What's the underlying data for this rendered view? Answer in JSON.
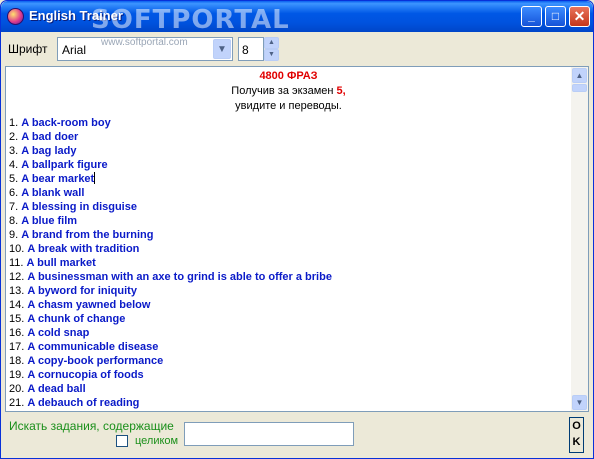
{
  "window": {
    "title": "English Trainer",
    "watermark": "SOFTPORTAL",
    "watermark_url": "www.softportal.com",
    "minimize": "_",
    "maximize": "□",
    "close": "✕"
  },
  "toolbar": {
    "font_label": "Шрифт",
    "font_value": "Arial",
    "size_value": "8"
  },
  "content": {
    "count": "4800 ФРАЗ",
    "line1_prefix": "Получив за экзамен ",
    "line1_num": "5,",
    "line2": "увидите и переводы.",
    "phrases": [
      {
        "num": "1.",
        "text": "A back-room boy"
      },
      {
        "num": "2.",
        "text": "A bad doer"
      },
      {
        "num": "3.",
        "text": "A bag lady"
      },
      {
        "num": "4.",
        "text": "A ballpark figure"
      },
      {
        "num": "5.",
        "text": "A bear market"
      },
      {
        "num": "6.",
        "text": "A blank wall"
      },
      {
        "num": "7.",
        "text": "A blessing in disguise"
      },
      {
        "num": "8.",
        "text": "A blue film"
      },
      {
        "num": "9.",
        "text": "A brand from the burning"
      },
      {
        "num": "10.",
        "text": "A break with tradition"
      },
      {
        "num": "11.",
        "text": "A bull market"
      },
      {
        "num": "12.",
        "text": "A businessman with an axe to grind is able to offer a bribe"
      },
      {
        "num": "13.",
        "text": "A byword for iniquity"
      },
      {
        "num": "14.",
        "text": "A chasm yawned below"
      },
      {
        "num": "15.",
        "text": "A chunk of change"
      },
      {
        "num": "16.",
        "text": "A cold snap"
      },
      {
        "num": "17.",
        "text": "A communicable disease"
      },
      {
        "num": "18.",
        "text": "A copy-book performance"
      },
      {
        "num": "19.",
        "text": "A cornucopia of foods"
      },
      {
        "num": "20.",
        "text": "A dead ball"
      },
      {
        "num": "21.",
        "text": "A debauch of reading"
      }
    ]
  },
  "bottom": {
    "search_label": "Искать задания, содержащие",
    "whole_word_label": "целиком",
    "search_value": "",
    "ok_top": "O",
    "ok_bottom": "K"
  },
  "colors": {
    "phrase_text": "#0A1AC8",
    "count_red": "#E00000",
    "label_green": "#1A8F1A",
    "titlebar_blue": "#0058E6"
  }
}
